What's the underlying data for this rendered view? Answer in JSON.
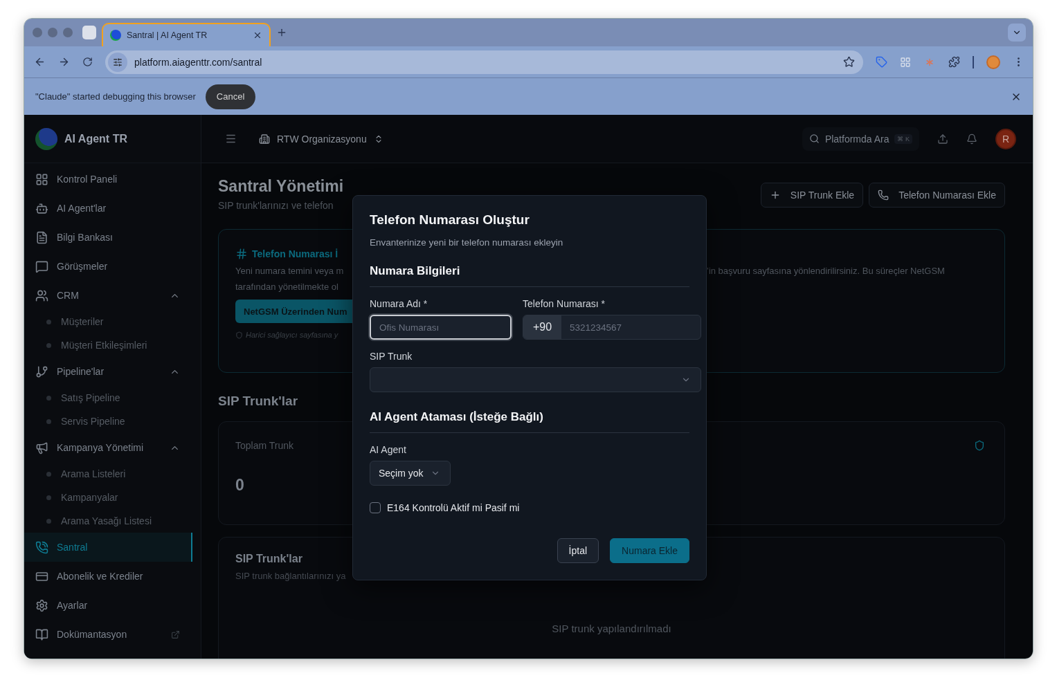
{
  "browser": {
    "tab": {
      "title": "Santral | AI Agent TR",
      "selected": true
    },
    "url": "platform.aiagenttr.com/santral",
    "debug_bar": {
      "message": "\"Claude\" started debugging this browser",
      "button": "Cancel"
    }
  },
  "app": {
    "brand": "AI Agent TR",
    "sidebar": {
      "items": [
        {
          "label": "Kontrol Paneli",
          "selected": false
        },
        {
          "label": "AI Agent'lar",
          "selected": false
        },
        {
          "label": "Bilgi Bankası",
          "selected": false
        },
        {
          "label": "Görüşmeler",
          "selected": false
        },
        {
          "label": "CRM",
          "selected": false,
          "expanded": true,
          "children": [
            {
              "label": "Müşteriler"
            },
            {
              "label": "Müşteri Etkileşimleri"
            }
          ]
        },
        {
          "label": "Pipeline'lar",
          "selected": false,
          "expanded": true,
          "children": [
            {
              "label": "Satış Pipeline"
            },
            {
              "label": "Servis Pipeline"
            }
          ]
        },
        {
          "label": "Kampanya Yönetimi",
          "selected": false,
          "expanded": true,
          "children": [
            {
              "label": "Arama Listeleri"
            },
            {
              "label": "Kampanyalar"
            },
            {
              "label": "Arama Yasağı Listesi"
            }
          ]
        },
        {
          "label": "Santral",
          "selected": true
        },
        {
          "label": "Abonelik ve Krediler",
          "selected": false
        },
        {
          "label": "Ayarlar",
          "selected": false
        },
        {
          "label": "Dokümantasyon",
          "selected": false,
          "external": true
        }
      ]
    },
    "header": {
      "organization": "RTW Organizasyonu",
      "search_placeholder": "Platformda Ara",
      "search_shortcut": "⌘ K",
      "avatar_initial": "R"
    },
    "page": {
      "title": "Santral Yönetimi",
      "subtitle": "SIP trunk'larınızı ve telefon",
      "actions": [
        {
          "label": "SIP Trunk Ekle"
        },
        {
          "label": "Telefon Numarası Ekle"
        }
      ],
      "info_card": {
        "title": "Telefon Numarası İ",
        "lines_left": [
          "Yeni numara temini veya m",
          "tarafından yönetilmekte ol"
        ],
        "line_right": "’in başvuru sayfasına yönlendirilirsiniz. Bu süreçler NetGSM",
        "button": "NetGSM Üzerinden Num",
        "note": "Harici sağlayıcı sayfasına y"
      },
      "section_title": "SIP Trunk'lar",
      "stat_card": {
        "label": "Toplam Trunk",
        "value": "0"
      },
      "trunks_card": {
        "title": "SIP Trunk'lar",
        "subtitle": "SIP trunk bağlantılarınızı ya",
        "empty": "SIP trunk yapılandırılmadı"
      }
    }
  },
  "dialog": {
    "title": "Telefon Numarası Oluştur",
    "description": "Envanterinize yeni bir telefon numarası ekleyin",
    "sections": [
      {
        "title": "Numara Bilgileri",
        "fields": [
          {
            "kind": "text",
            "label": "Numara Adı *",
            "placeholder": "Ofis Numarası",
            "focused": true
          },
          {
            "kind": "phone",
            "label": "Telefon Numarası *",
            "prefix": "+90",
            "placeholder": "5321234567",
            "focused": false
          },
          {
            "kind": "select",
            "label": "SIP Trunk"
          }
        ]
      },
      {
        "title": "AI Agent Ataması (İsteğe Bağlı)",
        "fields": [
          {
            "kind": "dropdown",
            "label": "AI Agent",
            "value": "Seçim yok"
          }
        ]
      }
    ],
    "checkbox": {
      "label": "E164 Kontrolü Aktif mi Pasif mi",
      "checked": false
    },
    "buttons": [
      {
        "kind": "secondary",
        "label": "İptal"
      },
      {
        "kind": "primary",
        "label": "Numara Ekle"
      }
    ]
  }
}
